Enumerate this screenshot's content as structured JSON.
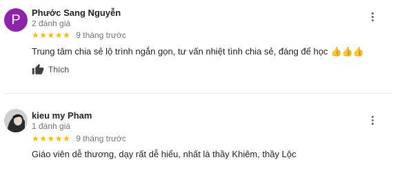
{
  "reviews": [
    {
      "avatar_letter": "P",
      "avatar_color": "#8e24aa",
      "name": "Phước Sang Nguyễn",
      "review_count": "2 đánh giá",
      "stars": "★★★★★",
      "time": "9 tháng trước",
      "text": "Trung tâm chia sẻ lộ trình ngắn gọn, tư vấn nhiệt tình chia sẻ, đáng để học",
      "emoji": "👍👍👍",
      "like_label": "Thích"
    },
    {
      "name": "kieu my Pham",
      "review_count": "1 đánh giá",
      "stars": "★★★★★",
      "time": "9 tháng trước",
      "text": "Giáo viên dễ thương, dạy rất dễ hiểu, nhất là thầy Khiêm, thầy Lộc"
    }
  ],
  "colors": {
    "star": "#fbbc04",
    "muted": "#70757a",
    "divider": "#e8eaed"
  },
  "icons": {
    "menu": "more-vert-icon",
    "like": "thumb-up-icon"
  }
}
